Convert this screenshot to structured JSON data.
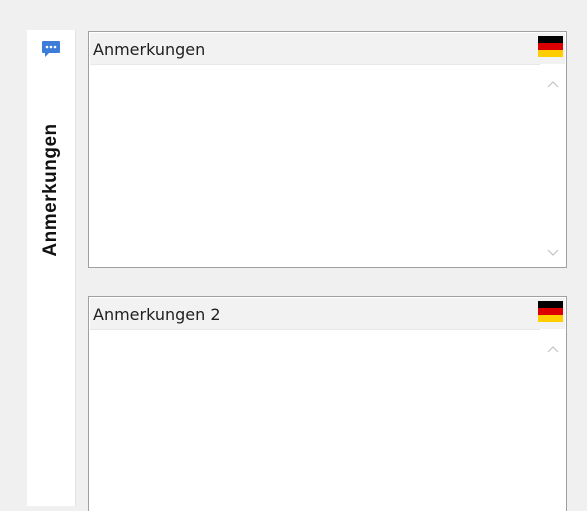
{
  "side_tab": {
    "label": "Anmerkungen",
    "icon": "comment-icon",
    "icon_color": "#3b7dd8"
  },
  "memos": [
    {
      "title": "Anmerkungen",
      "language_flag": "german-flag-icon",
      "value": ""
    },
    {
      "title": "Anmerkungen 2",
      "language_flag": "german-flag-icon",
      "value": ""
    }
  ],
  "colors": {
    "flag_black": "#000000",
    "flag_red": "#dd0000",
    "flag_gold": "#ffce00"
  }
}
